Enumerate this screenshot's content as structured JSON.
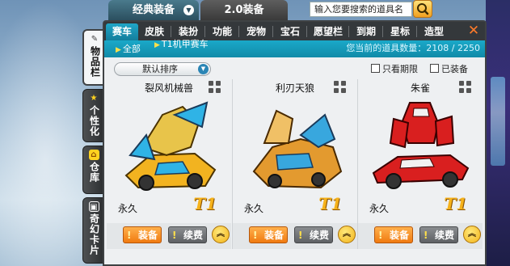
{
  "top_tabs": [
    {
      "label": "经典装备",
      "active": true
    },
    {
      "label": "2.0装备",
      "active": false
    }
  ],
  "search": {
    "value": "输入您要搜索的道具名"
  },
  "side_tabs": [
    {
      "label": "物品栏",
      "icon": "wrench-icon",
      "selected": true
    },
    {
      "label": "个性化",
      "icon": "star-icon",
      "selected": false
    },
    {
      "label": "仓库",
      "icon": "house-icon",
      "selected": false
    },
    {
      "label": "奇幻卡片",
      "icon": "card-icon",
      "selected": false
    }
  ],
  "categories": [
    "赛车",
    "皮肤",
    "装扮",
    "功能",
    "宠物",
    "宝石",
    "愿望栏",
    "到期",
    "星标",
    "造型"
  ],
  "filters": [
    {
      "label": "全部"
    },
    {
      "label": "T1机甲赛车"
    }
  ],
  "item_count": {
    "text": "您当前的道具数量：2108 / 2250"
  },
  "sort": {
    "label": "默认排序"
  },
  "checkboxes": [
    {
      "label": "只看期限",
      "checked": false
    },
    {
      "label": "已装备",
      "checked": false
    }
  ],
  "items": [
    {
      "name": "裂风机械兽",
      "duration": "永久",
      "tier": "T1",
      "equip_label": "装备",
      "renew_label": "续费",
      "colors": {
        "body": "#f2b320",
        "accent": "#2fb3e6"
      }
    },
    {
      "name": "利刃天狼",
      "duration": "永久",
      "tier": "T1",
      "equip_label": "装备",
      "renew_label": "续费",
      "colors": {
        "body": "#e39a2f",
        "accent": "#38a7de"
      }
    },
    {
      "name": "朱雀",
      "duration": "永久",
      "tier": "T1",
      "equip_label": "装备",
      "renew_label": "续费",
      "colors": {
        "body": "#d91f1f",
        "accent": "#f2f2f2"
      }
    }
  ],
  "close_label": "✕",
  "colors": {
    "accent": "#1aa9c9",
    "panel": "#eef0f2",
    "tabbar": "#34383b",
    "equip": "#f07a10",
    "tier": "#f6b21a"
  }
}
